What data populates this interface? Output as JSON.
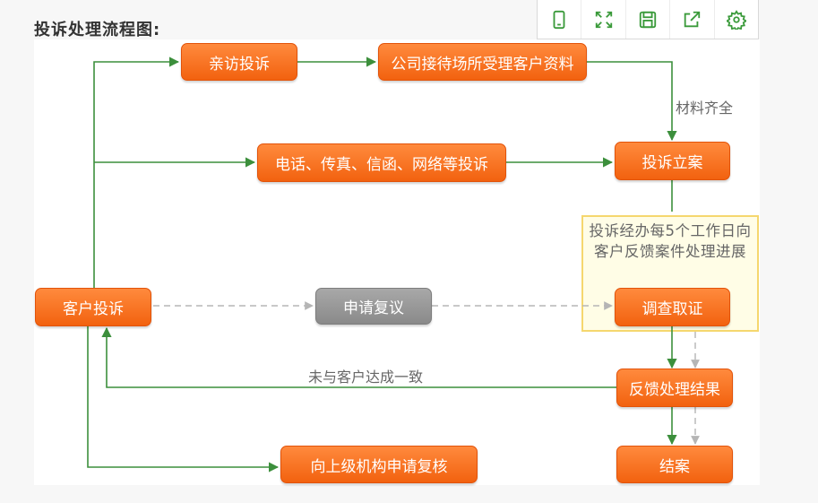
{
  "heading": "投诉处理流程图:",
  "toolbar": [
    {
      "name": "tablet-icon"
    },
    {
      "name": "fullscreen-icon"
    },
    {
      "name": "save-icon"
    },
    {
      "name": "share-icon"
    },
    {
      "name": "settings-icon"
    }
  ],
  "colors": {
    "node_orange": "#f46a16",
    "node_gray": "#8f8f8f",
    "flow_green": "#3c8f3c",
    "dashed_gray": "#b5b5b5",
    "note_border": "#f5d76e"
  },
  "diagram": {
    "nodes": {
      "customer_complaint": "客户投诉",
      "visit_complaint": "亲访投诉",
      "reception_docs": "公司接待场所受理客户资料",
      "remote_complaint": "电话、传真、信函、网络等投诉",
      "filing": "投诉立案",
      "review_request": "申请复议",
      "investigation": "调查取证",
      "feedback": "反馈处理结果",
      "closure": "结案",
      "escalation": "向上级机构申请复核"
    },
    "note": "投诉经办每5个工作日向客户反馈案件处理进展",
    "edge_labels": {
      "materials_complete": "材料齐全",
      "no_agreement": "未与客户达成一致"
    }
  }
}
